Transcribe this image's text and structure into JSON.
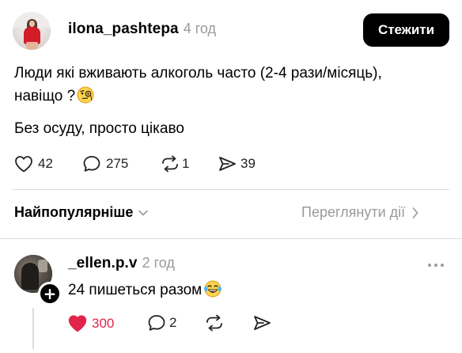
{
  "post": {
    "username": "ilona_pashtepa",
    "time_ago": "4 год",
    "follow_label": "Стежити",
    "text_line1": "Люди які вживають алкоголь часто (2-4 рази/місяць),",
    "text_line2": "навіщо ?",
    "text_line2_emoji": "face-with-monocle-icon",
    "text_line3": "Без осуду, просто цікаво",
    "likes": "42",
    "replies": "275",
    "reposts": "1",
    "shares": "39"
  },
  "sort": {
    "label": "Найпопулярніше",
    "view_activity": "Переглянути дії"
  },
  "reply": {
    "username": "_ellen.p.v",
    "time_ago": "2 год",
    "text": "24 пишеться разом",
    "text_emoji": "face-with-tears-of-joy-icon",
    "likes": "300",
    "replies": "2",
    "liked": true
  },
  "colors": {
    "like_active": "#e0244a",
    "muted_text": "#9a9a9a",
    "divider": "#dcdcdc",
    "follow_button_bg": "#000000"
  }
}
